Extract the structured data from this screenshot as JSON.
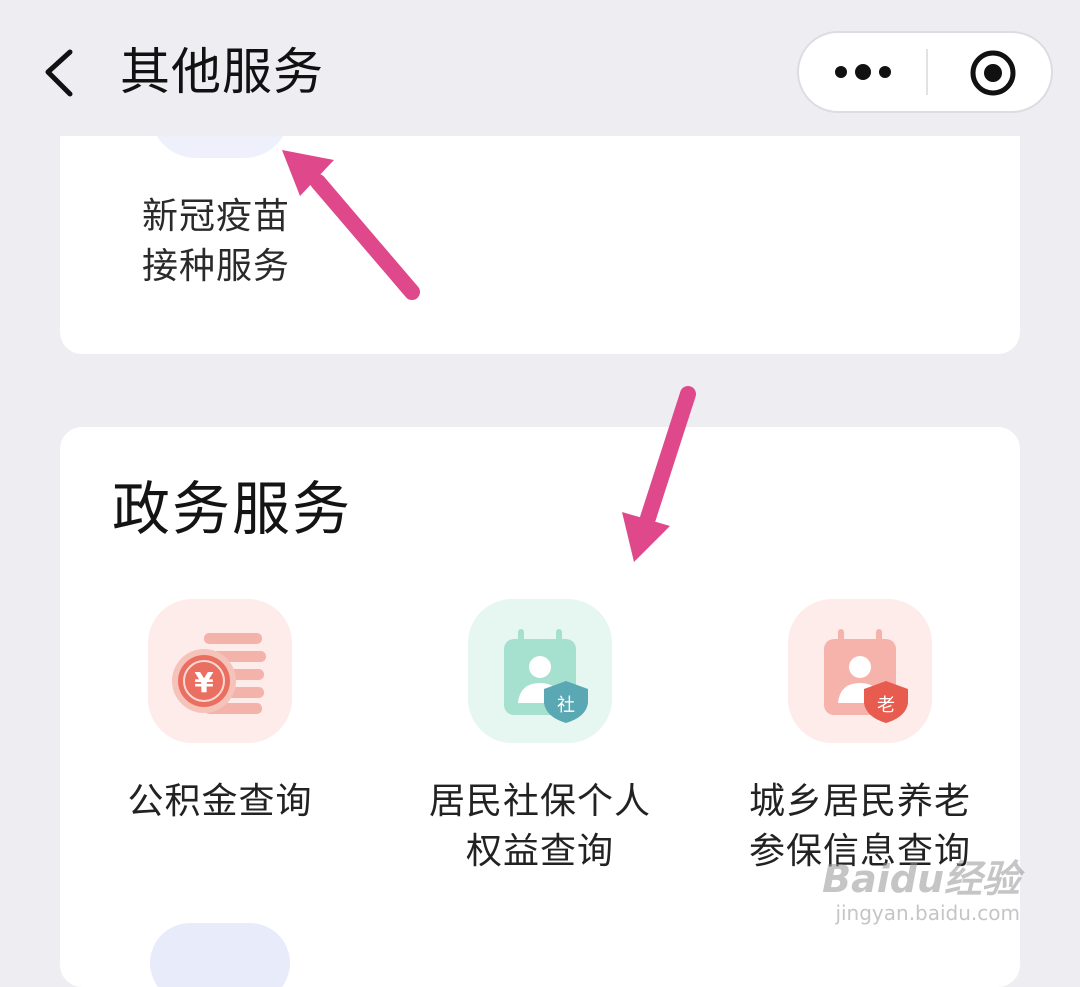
{
  "header": {
    "title": "其他服务",
    "back_icon": "chevron-left-icon",
    "more_icon": "more-dots-icon",
    "close_icon": "target-circle-icon"
  },
  "vaccine_card": {
    "item": {
      "label_line1": "新冠疫苗",
      "label_line2": "接种服务"
    }
  },
  "gov_section": {
    "title": "政务服务",
    "items": [
      {
        "label_line1": "公积金查询",
        "label_line2": "",
        "icon": "yuan-coins-icon",
        "tint": "#fdecea"
      },
      {
        "label_line1": "居民社保个人",
        "label_line2": "权益查询",
        "icon": "social-security-calendar-icon",
        "tint": "#e6f6f1",
        "badge": "社"
      },
      {
        "label_line1": "城乡居民养老",
        "label_line2": "参保信息查询",
        "icon": "pension-calendar-icon",
        "tint": "#fdecea",
        "badge": "老"
      }
    ]
  },
  "colors": {
    "page_bg": "#ededf2",
    "card_bg": "#ffffff",
    "annotation_arrow": "#e0488c"
  },
  "watermark": {
    "line1": "Baidu经验",
    "line2": "jingyan.baidu.com"
  }
}
